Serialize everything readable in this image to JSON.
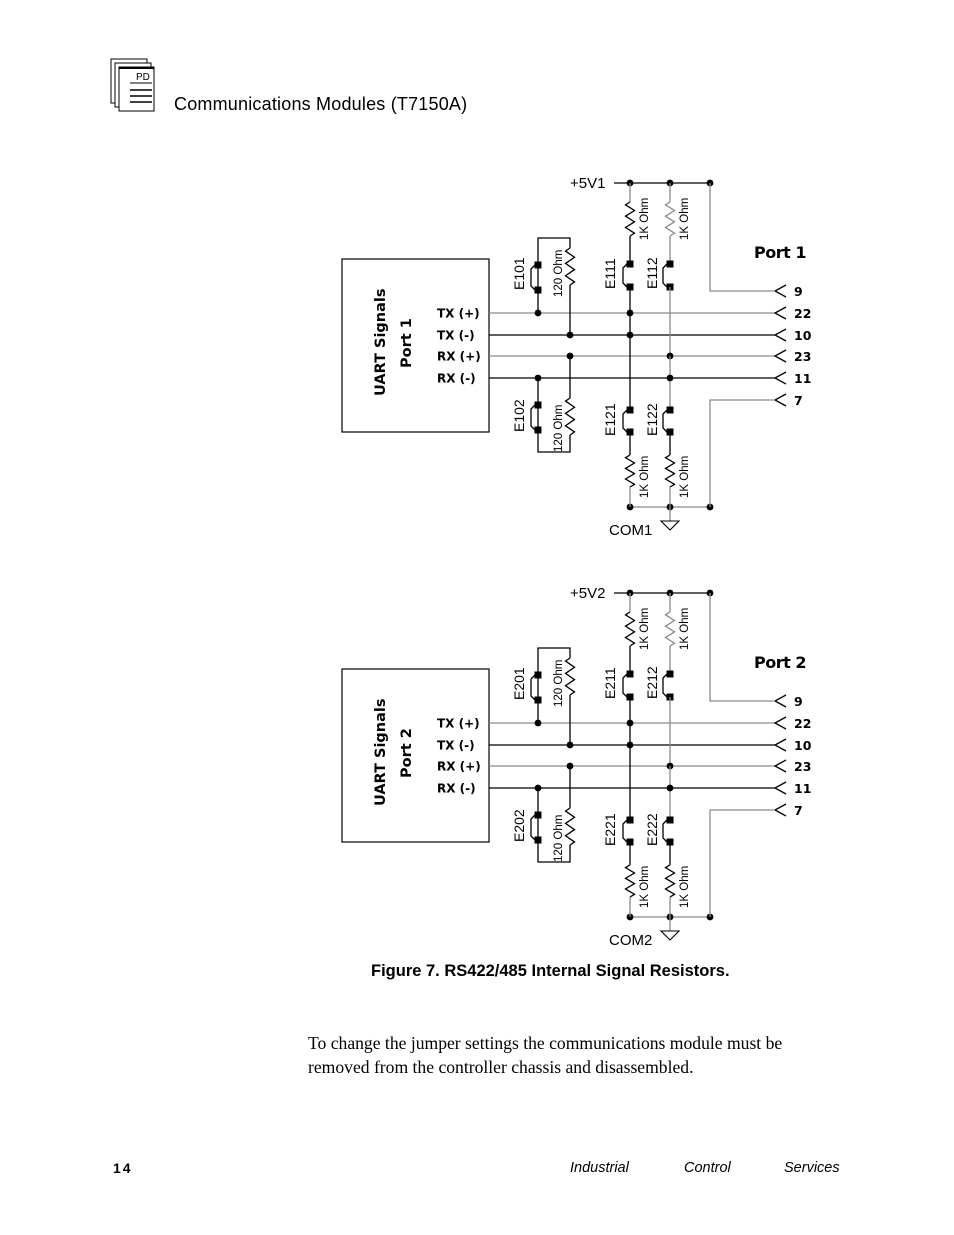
{
  "header": {
    "icon": "pd-document-stack-icon",
    "icon_text": "PD",
    "title": "Communications Modules (T7150A)"
  },
  "figure": {
    "caption": "Figure 7.  RS422/485 Internal Signal Resistors.",
    "ports": [
      {
        "port_label": "Port  1",
        "uart_line1": "UART  Signals",
        "uart_line2": "Port  1",
        "supply_label": "+5V1",
        "ground_label": "COM1",
        "signals": [
          "TX  (+)",
          "TX  (-)",
          "RX  (+)",
          "RX  (-)"
        ],
        "pins": [
          "9",
          "22",
          "10",
          "23",
          "11",
          "7"
        ],
        "terminator_jumpers": [
          "E101",
          "E102"
        ],
        "terminator_resistor": "120 Ohm",
        "bias_jumpers_top": [
          "E111",
          "E112"
        ],
        "bias_jumpers_bottom": [
          "E121",
          "E122"
        ],
        "bias_resistor": "1K Ohm"
      },
      {
        "port_label": "Port  2",
        "uart_line1": "UART  Signals",
        "uart_line2": "Port  2",
        "supply_label": "+5V2",
        "ground_label": "COM2",
        "signals": [
          "TX  (+)",
          "TX  (-)",
          "RX  (+)",
          "RX  (-)"
        ],
        "pins": [
          "9",
          "22",
          "10",
          "23",
          "11",
          "7"
        ],
        "terminator_jumpers": [
          "E201",
          "E202"
        ],
        "terminator_resistor": "120 Ohm",
        "bias_jumpers_top": [
          "E211",
          "E212"
        ],
        "bias_jumpers_bottom": [
          "E221",
          "E222"
        ],
        "bias_resistor": "1K Ohm"
      }
    ]
  },
  "body": {
    "paragraph": "To change the jumper settings the communications module must be removed from the controller chassis and disassembled."
  },
  "footer": {
    "page_number": "14",
    "publisher_words": [
      "Industrial",
      "Control",
      "Services"
    ]
  },
  "colors": {
    "ink": "#000000",
    "gray_wire": "#8a8a8a",
    "paper": "#ffffff"
  }
}
